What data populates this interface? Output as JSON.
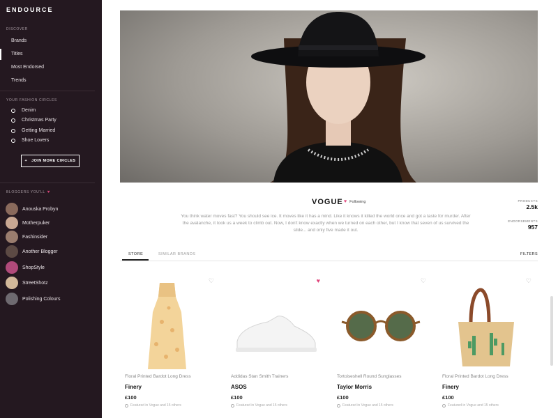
{
  "app": {
    "logo": "ENDOURCE"
  },
  "sidebar": {
    "discover_title": "DISCOVER",
    "nav": [
      {
        "label": "Brands"
      },
      {
        "label": "Titles",
        "active": true
      },
      {
        "label": "Most Endorsed"
      },
      {
        "label": "Trends"
      }
    ],
    "circles_title": "YOUR FASHION CIRCLES",
    "circles": [
      {
        "label": "Denim"
      },
      {
        "label": "Christmas Party"
      },
      {
        "label": "Getting Married"
      },
      {
        "label": "Shoe Lovers"
      }
    ],
    "join_button": "JOIN MORE CIRCLES",
    "bloggers_title": "BLOGGERS YOU'LL",
    "bloggers": [
      {
        "name": "Anouska Probyn",
        "avatar_color": "#8a6a5c"
      },
      {
        "name": "Motherpuker",
        "avatar_color": "#c9a893"
      },
      {
        "name": "Fashinsider",
        "avatar_color": "#9a7d6e"
      },
      {
        "name": "Another Blogger",
        "avatar_color": "#5c4a44"
      },
      {
        "name": "ShopStyle",
        "avatar_color": "#b04a7a"
      },
      {
        "name": "StreetShotz",
        "avatar_color": "#d2b89a"
      },
      {
        "name": "Polishing Colours",
        "avatar_color": "#6e6a70"
      }
    ]
  },
  "profile": {
    "title": "VOGUE",
    "following_label": "Following",
    "description": "You think water moves fast? You should see ice. It moves like it has a mind. Like it knows it killed the world once and got a taste for murder. After the avalanche, it took us a week to climb out. Now, I don't know exactly when we turned on each other, but I know that seven of us survived the slide... and only five made it out.",
    "products_label": "PRODUCTS",
    "products_value": "2.5k",
    "endorsements_label": "ENDORSEMENTS",
    "endorsements_value": "957"
  },
  "tabs": [
    {
      "label": "STORE",
      "active": true
    },
    {
      "label": "SIMILAR BRANDS"
    }
  ],
  "filters_label": "FILTERS",
  "products": [
    {
      "name": "Floral Printed Bardot Long Dress",
      "brand": "Finery",
      "price": "£100",
      "featured": "Featured in Vogue and 15 others",
      "liked": false
    },
    {
      "name": "Addidas Stan Smith Trainers",
      "brand": "ASOS",
      "price": "£100",
      "featured": "Featured in Vogue and 15 others",
      "liked": true
    },
    {
      "name": "Tortoiseshell Round Sunglasses",
      "brand": "Taylor Morris",
      "price": "£100",
      "featured": "Featured in Vogue and 15 others",
      "liked": false
    },
    {
      "name": "Floral Printed Bardot Long Dress",
      "brand": "Finery",
      "price": "£100",
      "featured": "Featured in Vogue and 15 others",
      "liked": false
    }
  ]
}
